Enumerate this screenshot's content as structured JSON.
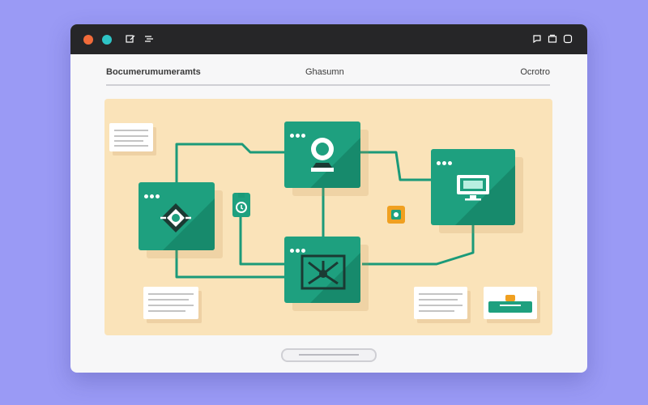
{
  "window": {
    "controls": [
      {
        "name": "close",
        "color": "#f26b3a"
      },
      {
        "name": "expand",
        "color": "#2ec4c6"
      }
    ],
    "toolbar_left_icons": [
      "edit-icon",
      "list-icon"
    ],
    "toolbar_right_icons": [
      "chat-icon",
      "tabs-icon",
      "window-icon"
    ]
  },
  "header": {
    "title": "Bocumerumumeramts",
    "center": "Ghasumn",
    "right": "Ocrotro"
  },
  "colors": {
    "background": "#9a9af5",
    "canvas": "#fae3b9",
    "node": "#1ea07f",
    "wire": "#1b9a79",
    "badge": "#f0a020"
  },
  "nodes": [
    {
      "name": "user-profile-node",
      "icon": "user-icon"
    },
    {
      "name": "decision-node",
      "icon": "diamond-move-icon"
    },
    {
      "name": "monitor-node",
      "icon": "monitor-icon"
    },
    {
      "name": "hub-node",
      "icon": "network-icon"
    }
  ],
  "connectors": [
    {
      "name": "device-connector",
      "icon": "device-icon"
    },
    {
      "name": "settings-connector",
      "icon": "settings-icon"
    }
  ],
  "cards": [
    "note-card-top-left",
    "note-card-bottom-left",
    "note-card-bottom-right",
    "profile-card"
  ]
}
